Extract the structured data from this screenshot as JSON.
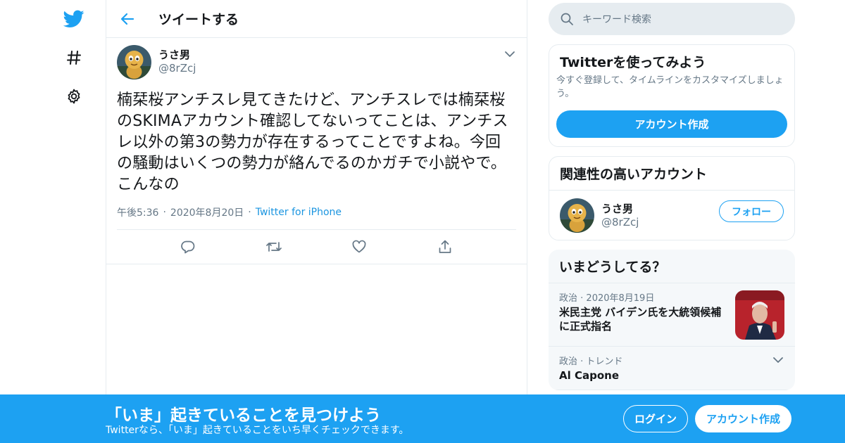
{
  "colors": {
    "accent": "#1da1f2",
    "border": "#e6ecf0",
    "muted": "#657786",
    "text": "#14171a"
  },
  "nav": {
    "icons": [
      "twitter-bird-icon",
      "hashtag-icon",
      "gear-icon"
    ]
  },
  "header": {
    "title": "ツイートする"
  },
  "tweet": {
    "author_name": "うさ男",
    "author_handle": "@8rZcj",
    "text": "楠栞桜アンチスレ見てきたけど、アンチスレでは楠栞桜のSKIMAアカウント確認してないってことは、アンチスレ以外の第3の勢力が存在するってことですよね。今回の騒動はいくつの勢力が絡んでるのかガチで小説やで。こんなの",
    "time": "午後5:36",
    "date": "2020年8月20日",
    "source": "Twitter for iPhone"
  },
  "search": {
    "placeholder": "キーワード検索"
  },
  "signup_card": {
    "title": "Twitterを使ってみよう",
    "description": "今すぐ登録して、タイムラインをカスタマイズしましょう。",
    "button": "アカウント作成"
  },
  "related": {
    "title": "関連性の高いアカウント",
    "name": "うさ男",
    "handle": "@8rZcj",
    "follow": "フォロー"
  },
  "trends": {
    "title": "いまどうしてる？",
    "items": [
      {
        "category": "政治",
        "date": "2020年8月19日",
        "name": "米民主党 バイデン氏を大統領候補に正式指名"
      },
      {
        "category": "政治",
        "date": "トレンド",
        "name": "Al Capone"
      }
    ]
  },
  "bottom_bar": {
    "headline": "「いま」起きていることを見つけよう",
    "sub": "Twitterなら、「いま」起きていることをいち早くチェックできます。",
    "login": "ログイン",
    "signup": "アカウント作成"
  }
}
